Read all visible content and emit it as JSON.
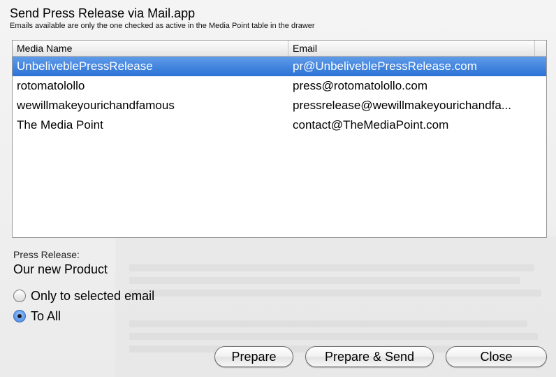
{
  "dialog": {
    "title": "Send Press Release via Mail.app",
    "subtitle": "Emails available are only the one checked as active in the Media Point table in the drawer"
  },
  "table": {
    "columns": [
      "Media Name",
      "Email"
    ],
    "rows": [
      {
        "name": "UnbeliveblePressRelease",
        "email": "pr@UnbeliveblePressRelease.com",
        "selected": true
      },
      {
        "name": "rotomatolollo",
        "email": "press@rotomatolollo.com",
        "selected": false
      },
      {
        "name": "wewillmakeyourichandfamous",
        "email": "pressrelease@wewillmakeyourichandfa...",
        "selected": false
      },
      {
        "name": "The Media Point",
        "email": "contact@TheMediaPoint.com",
        "selected": false
      }
    ]
  },
  "press_release": {
    "label": "Press Release:",
    "name": "Our new Product"
  },
  "recipients": {
    "options": [
      {
        "label": "Only to selected email",
        "checked": false
      },
      {
        "label": "To All",
        "checked": true
      }
    ]
  },
  "buttons": {
    "prepare": "Prepare",
    "prepare_send": "Prepare & Send",
    "close": "Close"
  },
  "colors": {
    "selection": "#2b72d6",
    "background": "#ececec"
  }
}
